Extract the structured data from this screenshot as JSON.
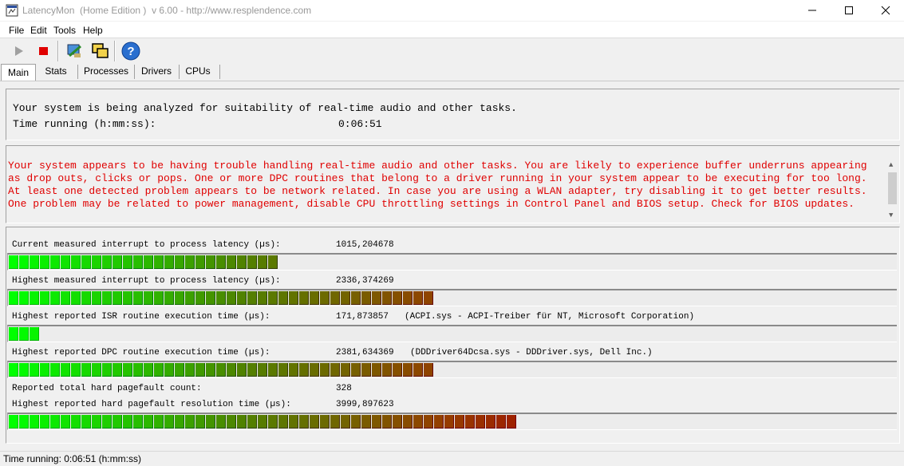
{
  "window": {
    "title": "LatencyMon  (Home Edition )  v 6.00 - http://www.resplendence.com"
  },
  "menu": [
    "File",
    "Edit",
    "Tools",
    "Help"
  ],
  "toolbar": {
    "buttons": [
      "play-icon",
      "stop-icon",
      "submit-icon",
      "windows-icon",
      "help-icon"
    ]
  },
  "tabs": [
    "Main",
    "Stats",
    "Processes",
    "Drivers",
    "CPUs"
  ],
  "active_tab": "Main",
  "status_panel": {
    "line1": "Your system is being analyzed for suitability of real-time audio and other tasks.",
    "time_label": "Time running (h:mm:ss):",
    "time_value": "0:06:51"
  },
  "warning": {
    "text": "Your system appears to be having trouble handling real-time audio and other tasks. You are likely to experience buffer underruns appearing as drop outs, clicks or pops. One or more DPC routines that belong to a driver running in your system appear to be executing for too long. At least one detected problem appears to be network related. In case you are using a WLAN adapter, try disabling it to get better results. One problem may be related to power management, disable CPU throttling settings in Control Panel and BIOS setup. Check for BIOS updates.",
    "color": "#e00000"
  },
  "metrics": [
    {
      "label": "Current measured interrupt to process latency (µs):",
      "value": "1015,204678",
      "note": "",
      "bar_segments": 26
    },
    {
      "label": "Highest measured interrupt to process latency (µs):",
      "value": "2336,374269",
      "note": "",
      "bar_segments": 41
    },
    {
      "label": "Highest reported ISR routine execution time (µs):",
      "value": "171,873857",
      "note": "(ACPI.sys - ACPI-Treiber für NT, Microsoft Corporation)",
      "bar_segments": 3
    },
    {
      "label": "Highest reported DPC routine execution time (µs):",
      "value": "2381,634369",
      "note": "(DDDriver64Dcsa.sys - DDDriver.sys, Dell Inc.)",
      "bar_segments": 41
    },
    {
      "label": "Reported total hard pagefault count:",
      "value": "328",
      "note": "",
      "bar_segments": null
    },
    {
      "label": "Highest reported hard pagefault resolution time (µs):",
      "value": "3999,897623",
      "note": "",
      "bar_segments": 49
    }
  ],
  "statusbar": {
    "text": "Time running: 0:06:51  (h:mm:ss)"
  }
}
